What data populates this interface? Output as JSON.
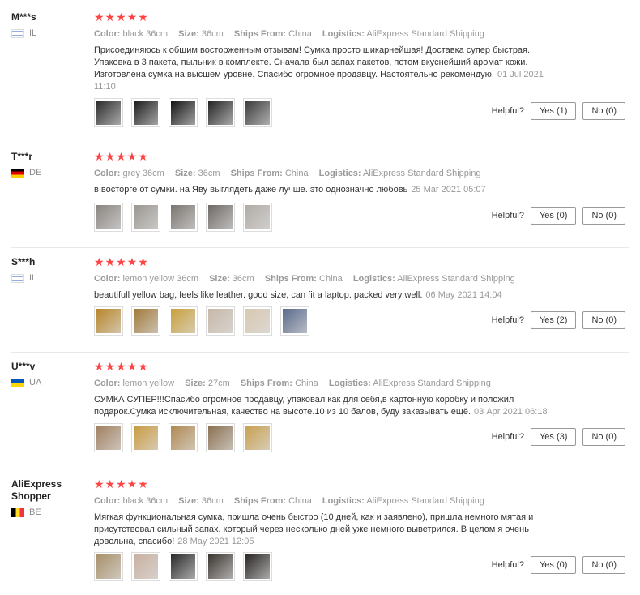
{
  "labels": {
    "color": "Color:",
    "size": "Size:",
    "ships_from": "Ships From:",
    "logistics": "Logistics:",
    "helpful": "Helpful?"
  },
  "reviews": [
    {
      "name": "M***s",
      "country": "IL",
      "flag": "il",
      "stars": "★★★★★",
      "color": "black 36cm",
      "size": "36cm",
      "ships_from": "China",
      "logistics": "AliExpress Standard Shipping",
      "text": "Присоединяюсь к общим восторженным отзывам! Сумка просто шикарнейшая! Доставка супер быстрая. Упаковка в 3 пакета, пыльник в комплекте. Сначала был запах пакетов, потом вкуснейший аромат кожи. Изготовлена сумка на высшем уровне. Спасибо огромное продавцу. Настоятельно рекомендую.",
      "date": "01 Jul 2021 11:10",
      "thumbs": [
        "#2a2a2a",
        "#1a1a1a",
        "#111111",
        "#222222",
        "#3a3a3a"
      ],
      "yes": "Yes (1)",
      "no": "No (0)"
    },
    {
      "name": "T***r",
      "country": "DE",
      "flag": "de",
      "stars": "★★★★★",
      "color": "grey 36cm",
      "size": "36cm",
      "ships_from": "China",
      "logistics": "AliExpress Standard Shipping",
      "text": "в восторге от сумки. на Яву выглядеть даже лучше. это однозначно любовь",
      "date": "25 Mar 2021 05:07",
      "thumbs": [
        "#8a8580",
        "#9a9690",
        "#7a7570",
        "#6f6a66",
        "#b0aba5"
      ],
      "yes": "Yes (0)",
      "no": "No (0)"
    },
    {
      "name": "S***h",
      "country": "IL",
      "flag": "il",
      "stars": "★★★★★",
      "color": "lemon yellow 36cm",
      "size": "36cm",
      "ships_from": "China",
      "logistics": "AliExpress Standard Shipping",
      "text": "beautifull yellow bag, feels like leather. good size, can fit a laptop. packed very well.",
      "date": "06 May 2021 14:04",
      "thumbs": [
        "#b8862a",
        "#a07a3a",
        "#c9a03a",
        "#c8b8a8",
        "#d8c8b0",
        "#5a6a8a"
      ],
      "yes": "Yes (2)",
      "no": "No (0)"
    },
    {
      "name": "U***v",
      "country": "UA",
      "flag": "ua",
      "stars": "★★★★★",
      "color": "lemon yellow",
      "size": "27cm",
      "ships_from": "China",
      "logistics": "AliExpress Standard Shipping",
      "text": "СУМКА СУПЕР!!!Спасибо огромное продавцу, упаковал как для себя,в картонную коробку и положил подарок.Сумка исключительная, качество на высоте.10 из 10 балов, буду заказывать ещё.",
      "date": "03 Apr 2021 06:18",
      "thumbs": [
        "#a08060",
        "#c89a40",
        "#b08850",
        "#8a7050",
        "#c8a050"
      ],
      "yes": "Yes (3)",
      "no": "No (0)"
    },
    {
      "name": "AliExpress Shopper",
      "country": "BE",
      "flag": "be",
      "stars": "★★★★★",
      "color": "black 36cm",
      "size": "36cm",
      "ships_from": "China",
      "logistics": "AliExpress Standard Shipping",
      "text": "Мягкая функциональная сумка, пришла очень быстро (10 дней, как и заявлено), пришла немного мятая и присутствовал сильный запах, который через несколько дней уже немного выветрился. В целом я очень довольна, спасибо!",
      "date": "28 May 2021 12:05",
      "thumbs": [
        "#a8906a",
        "#c8b0a0",
        "#2a2a2a",
        "#3a3530",
        "#2a2725"
      ],
      "yes": "Yes (0)",
      "no": "No (0)"
    }
  ]
}
